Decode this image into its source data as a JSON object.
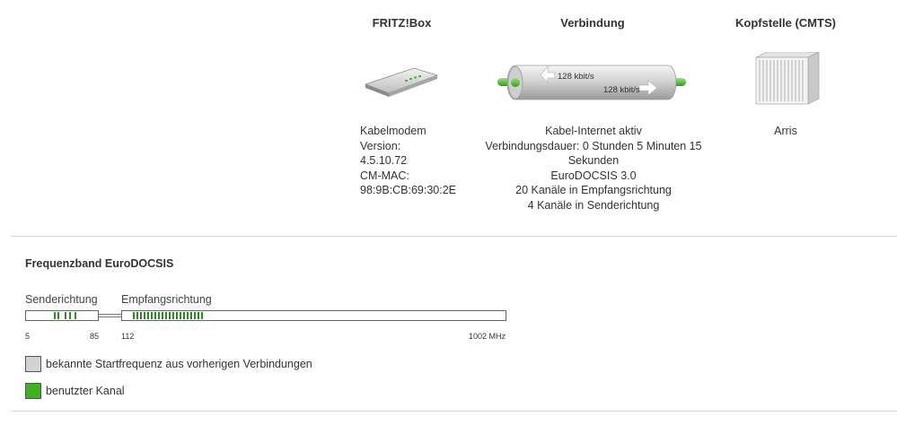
{
  "columns": {
    "fritzbox": {
      "title": "FRITZ!Box",
      "lines": [
        "Kabelmodem",
        "Version:",
        "4.5.10.72",
        "CM-MAC:",
        "98:9B:CB:69:30:2E"
      ]
    },
    "connection": {
      "title": "Verbindung",
      "rate_up": "128 kbit/s",
      "rate_down": "128 kbit/s",
      "lines": [
        "Kabel-Internet aktiv",
        "Verbindungsdauer: 0 Stunden 5 Minuten 15",
        "Sekunden",
        "EuroDOCSIS 3.0",
        "20 Kanäle in Empfangsrichtung",
        "4 Kanäle in Senderichtung"
      ]
    },
    "cmts": {
      "title": "Kopfstelle (CMTS)",
      "lines": [
        "Arris"
      ]
    }
  },
  "frequency": {
    "title": "Frequenzband EuroDOCSIS",
    "upstream_label": "Senderichtung",
    "downstream_label": "Empfangsrichtung",
    "ticks": [
      "5",
      "85",
      "112",
      "1002 MHz"
    ],
    "upstream_channels": 4,
    "downstream_channels": 20
  },
  "legend": [
    {
      "label": "bekannte Startfrequenz aus vorherigen Verbindungen",
      "color": "#d3d3d3"
    },
    {
      "label": "benutzter Kanal",
      "color": "#3cb21d"
    }
  ]
}
